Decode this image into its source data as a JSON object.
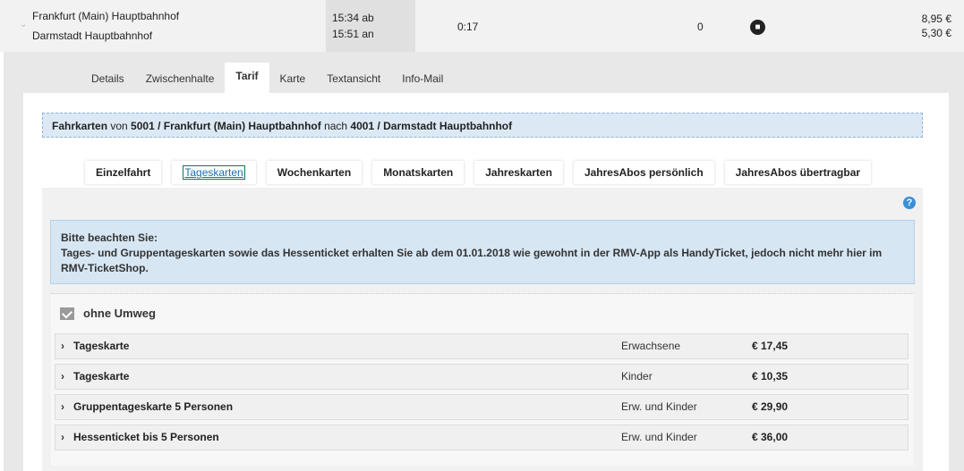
{
  "connection": {
    "from": "Frankfurt (Main) Hauptbahnhof",
    "to": "Darmstadt Hauptbahnhof",
    "dep": "15:34 ab",
    "arr": "15:51 an",
    "duration": "0:17",
    "changes": "0",
    "price1": "8,95 €",
    "price2": "5,30 €"
  },
  "tabs": [
    "Details",
    "Zwischenhalte",
    "Tarif",
    "Karte",
    "Textansicht",
    "Info-Mail"
  ],
  "banner": {
    "prefix": "Fahrkarten",
    "von": " von ",
    "from": "5001 / Frankfurt (Main) Hauptbahnhof",
    "nach": " nach ",
    "to": "4001 / Darmstadt Hauptbahnhof"
  },
  "subtabs": [
    "Einzelfahrt",
    "Tageskarten",
    "Wochenkarten",
    "Monatskarten",
    "Jahreskarten",
    "JahresAbos persönlich",
    "JahresAbos übertragbar"
  ],
  "notice": {
    "title": "Bitte beachten Sie:",
    "text": "Tages- und Gruppentageskarten sowie das Hessenticket erhalten Sie ab dem 01.01.2018 wie gewohnt in der RMV-App als HandyTicket, jedoch nicht mehr hier im RMV-TicketShop."
  },
  "section": {
    "title": "ohne Umweg"
  },
  "tickets": [
    {
      "name": "Tageskarte",
      "who": "Erwachsene",
      "price": "€ 17,45"
    },
    {
      "name": "Tageskarte",
      "who": "Kinder",
      "price": "€ 10,35"
    },
    {
      "name": "Gruppentageskarte 5 Personen",
      "who": "Erw. und Kinder",
      "price": "€ 29,90"
    },
    {
      "name": "Hessenticket bis 5 Personen",
      "who": "Erw. und Kinder",
      "price": "€ 36,00"
    }
  ]
}
